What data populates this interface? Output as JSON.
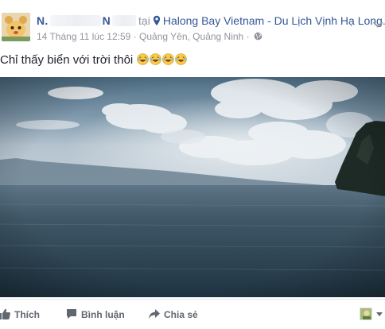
{
  "post": {
    "author_initial_1": "N.",
    "author_initial_2": "N",
    "at_text": "tại",
    "place": "Halong Bay Vietnam - Du Lịch Vịnh Hạ Long",
    "timestamp": "14 Tháng 11 lúc 12:59",
    "separator": "·",
    "location": "Quảng Yên, Quảng Ninh",
    "separator2": "·",
    "caption": "Chỉ thấy biển với trời thôi",
    "caption_emoji": [
      "laughing-face",
      "laughing-face",
      "laughing-face",
      "laughing-face"
    ],
    "privacy_icon": "globe-icon",
    "menu_icon": "chevron-down-icon"
  },
  "actions": {
    "like_label": "Thích",
    "comment_label": "Bình luận",
    "share_label": "Chia sẻ",
    "like_icon": "thumbs-up-icon",
    "comment_icon": "comment-icon",
    "share_icon": "share-arrow-icon"
  },
  "colors": {
    "link": "#365899",
    "meta": "#90949c",
    "action": "#616770",
    "text": "#1d2129"
  }
}
